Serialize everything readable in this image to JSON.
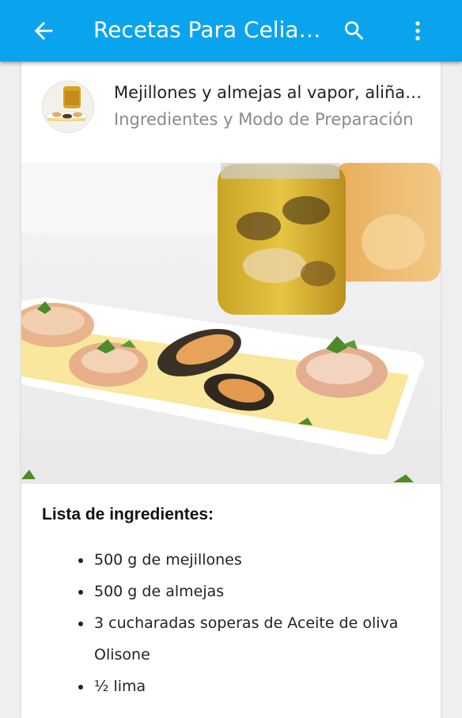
{
  "appbar": {
    "title": "Recetas Para Celiacos",
    "color": "#0aa4ee",
    "back_icon": "arrow-back-icon",
    "search_icon": "search-icon",
    "more_icon": "more-vert-icon"
  },
  "recipe": {
    "title": "Mejillones y almejas al vapor, aliñados",
    "subtitle": "Ingredientes y Modo de Preparación"
  },
  "ingredients": {
    "heading": "Lista de ingredientes:",
    "items": [
      "500 g de mejillones",
      "500 g de almejas",
      "3 cucharadas soperas de Aceite de oliva Olisone",
      "½ lima"
    ]
  }
}
